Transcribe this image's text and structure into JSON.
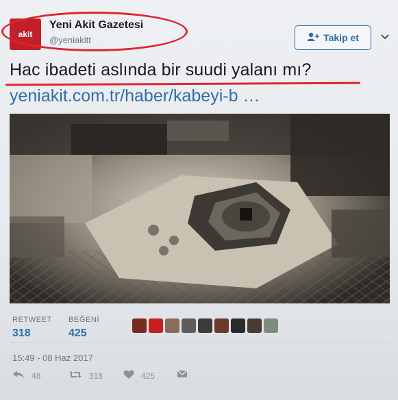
{
  "header": {
    "avatar_text": "akit",
    "display_name": "Yeni Akit Gazetesi",
    "handle": "@yeniakitt",
    "follow_label": "Takip et"
  },
  "tweet": {
    "text": "Hac ibadeti aslında bir suudi yalanı mı?",
    "link": "yeniakit.com.tr/haber/kabeyi-b …"
  },
  "stats": {
    "retweet_label": "RETWEET",
    "retweet_count": "318",
    "like_label": "BEĞENİ",
    "like_count": "425"
  },
  "likers": [
    {
      "color": "#7a2a20"
    },
    {
      "color": "#c81e1e"
    },
    {
      "color": "#8a6c5a"
    },
    {
      "color": "#5d5d5d"
    },
    {
      "color": "#3c3c3c"
    },
    {
      "color": "#6c3a2c"
    },
    {
      "color": "#2a2a2a"
    },
    {
      "color": "#4a3a36"
    },
    {
      "color": "#7d8c80"
    }
  ],
  "timestamp": "15:49 - 08 Haz 2017",
  "actions": {
    "reply_count": "48",
    "retweet_count": "318",
    "like_count": "425"
  },
  "colors": {
    "accent": "#2f6ea8",
    "annotation_red": "#e0242f",
    "brand_red": "#c21f2a"
  }
}
